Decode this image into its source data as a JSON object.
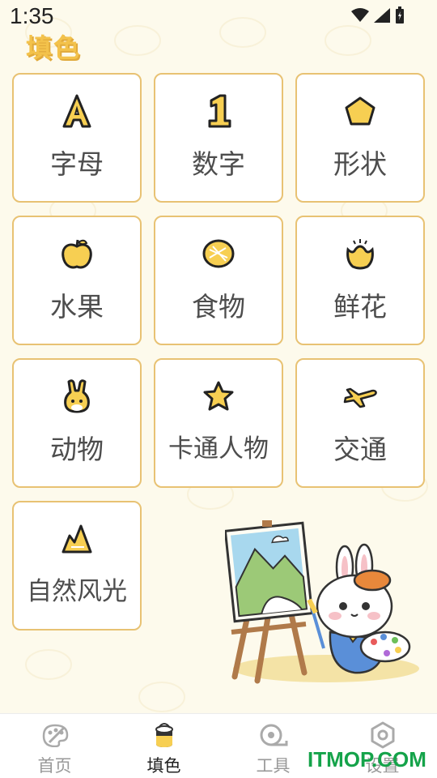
{
  "status": {
    "time": "1:35"
  },
  "header": {
    "title": "填色"
  },
  "categories": [
    {
      "label": "字母",
      "icon": "letter-a-icon"
    },
    {
      "label": "数字",
      "icon": "number-1-icon"
    },
    {
      "label": "形状",
      "icon": "pentagon-icon"
    },
    {
      "label": "水果",
      "icon": "apple-icon"
    },
    {
      "label": "食物",
      "icon": "bread-icon"
    },
    {
      "label": "鲜花",
      "icon": "flower-icon"
    },
    {
      "label": "动物",
      "icon": "rabbit-icon"
    },
    {
      "label": "卡通人物",
      "icon": "star-icon"
    },
    {
      "label": "交通",
      "icon": "airplane-icon"
    },
    {
      "label": "自然风光",
      "icon": "mountain-icon"
    }
  ],
  "nav": [
    {
      "label": "首页",
      "icon": "palette-icon"
    },
    {
      "label": "填色",
      "icon": "paint-bucket-icon"
    },
    {
      "label": "工具",
      "icon": "tape-icon"
    },
    {
      "label": "设置",
      "icon": "hexagon-nut-icon"
    }
  ],
  "watermark": "ITMOP.COM",
  "colors": {
    "accent": "#f3c24b",
    "border": "#e8c273",
    "background": "#fdfaec"
  }
}
